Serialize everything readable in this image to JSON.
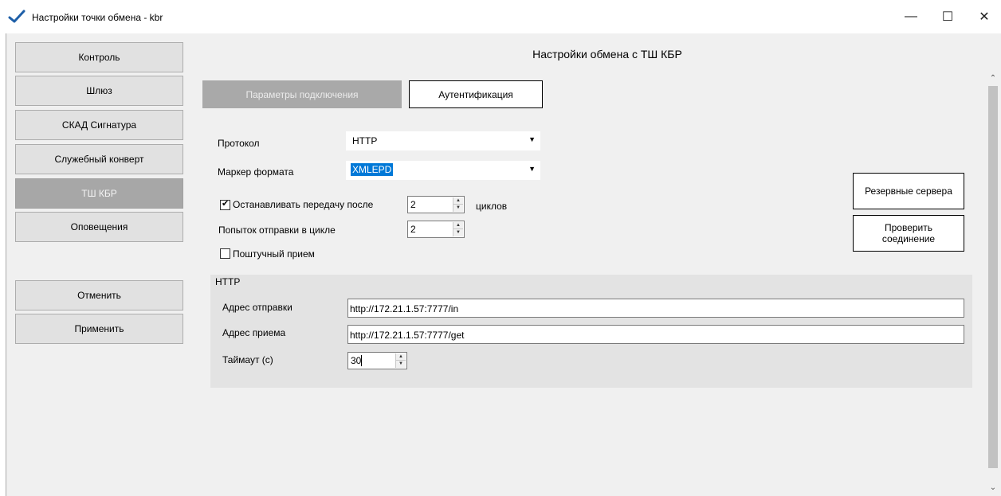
{
  "window": {
    "title": "Настройки точки обмена - kbr",
    "controls": {
      "minimize": "—",
      "maximize": "☐",
      "close": "✕"
    }
  },
  "nav": {
    "items": [
      {
        "label": "Контроль",
        "active": false
      },
      {
        "label": "Шлюз",
        "active": false
      },
      {
        "label": "СКАД Сигнатура",
        "active": false
      },
      {
        "label": "Служебный конверт",
        "active": false
      },
      {
        "label": "ТШ КБР",
        "active": true
      },
      {
        "label": "Оповещения",
        "active": false
      }
    ],
    "cancel_label": "Отменить",
    "apply_label": "Применить"
  },
  "main": {
    "header": "Настройки обмена с ТШ КБР",
    "tabs": [
      {
        "label": "Параметры подключения",
        "active": true
      },
      {
        "label": "Аутентификация",
        "active": false
      }
    ],
    "protocol": {
      "label": "Протокол",
      "value": "HTTP"
    },
    "format_marker": {
      "label": "Маркер формата",
      "value": "XMLEPD"
    },
    "stop_transfer": {
      "label": "Останавливать передачу после",
      "checked": true,
      "value": "2",
      "suffix": "циклов"
    },
    "attempts": {
      "label": "Попыток отправки в цикле",
      "value": "2"
    },
    "piecewise": {
      "label": "Поштучный прием",
      "checked": false
    },
    "backup_servers_label": "Резервные сервера",
    "check_connection_label": "Проверить соединение"
  },
  "http_group": {
    "title": "HTTP",
    "send_address": {
      "label": "Адрес отправки",
      "value": "http://172.21.1.57:7777/in"
    },
    "receive_address": {
      "label": "Адрес приема",
      "value": "http://172.21.1.57:7777/get"
    },
    "timeout": {
      "label": "Таймаут (с)",
      "value": "30"
    }
  },
  "colors": {
    "active_nav": "#a7a7a7",
    "selection": "#0078d7",
    "group_bg": "#e3e3e3"
  }
}
